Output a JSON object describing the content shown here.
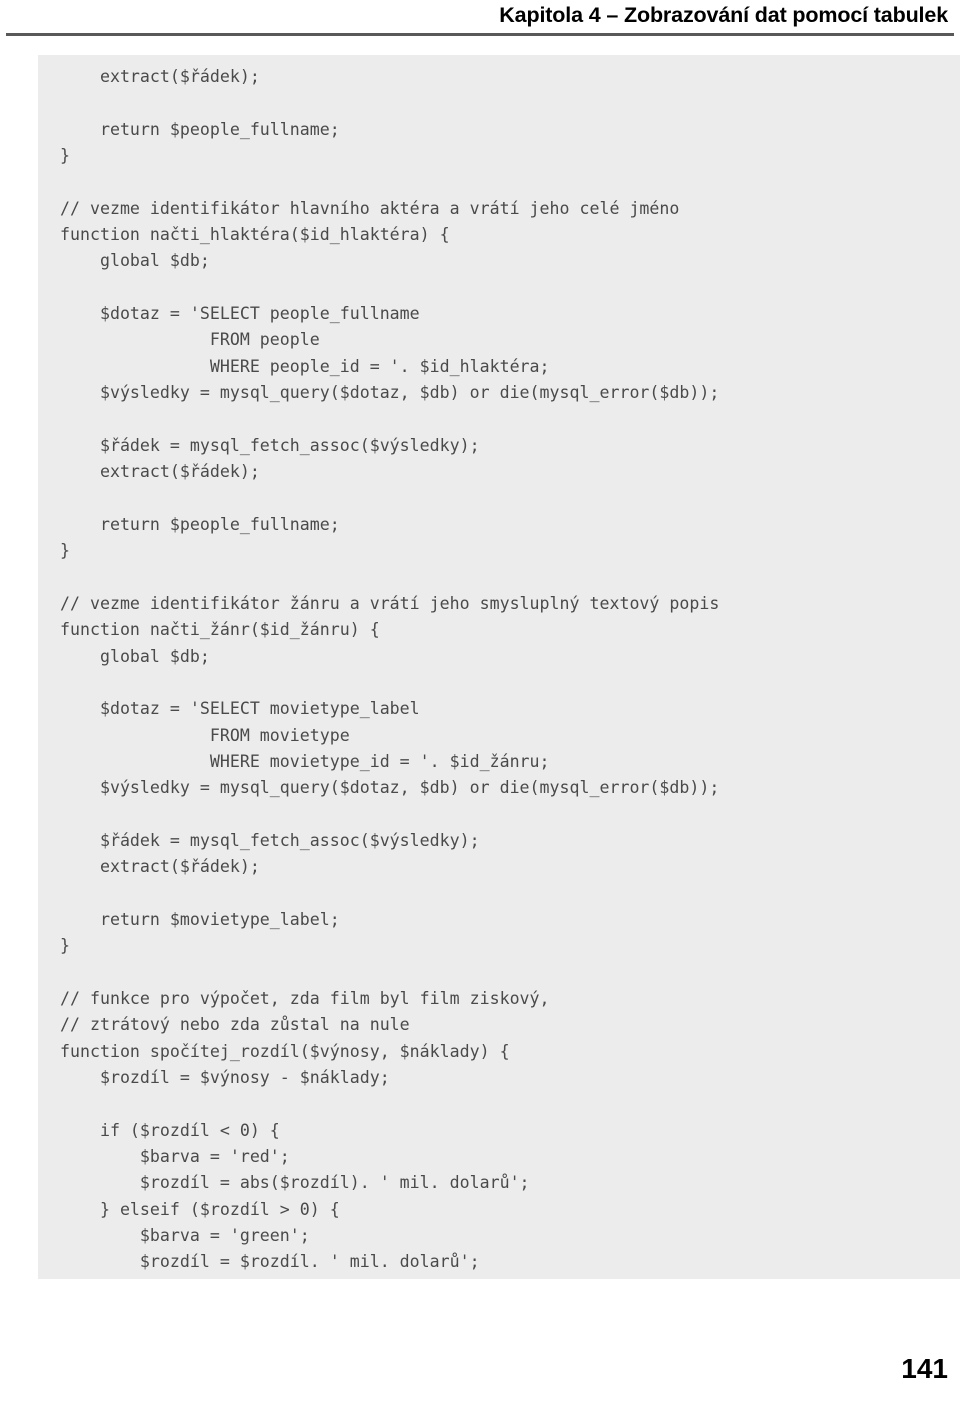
{
  "running_head": {
    "title": "Kapitola 4 – Zobrazování dat pomocí tabulek"
  },
  "folio": {
    "page_number": "141"
  },
  "code_block": {
    "language": "php",
    "background_color": "#ececec",
    "text_color": "#4a4a4a",
    "lines": [
      "    extract($řádek);",
      "",
      "    return $people_fullname;",
      "}",
      "",
      "// vezme identifikátor hlavního aktéra a vrátí jeho celé jméno",
      "function načti_hlaktéra($id_hlaktéra) {",
      "    global $db;",
      "",
      "    $dotaz = 'SELECT people_fullname",
      "               FROM people",
      "               WHERE people_id = '. $id_hlaktéra;",
      "    $výsledky = mysql_query($dotaz, $db) or die(mysql_error($db));",
      "",
      "    $řádek = mysql_fetch_assoc($výsledky);",
      "    extract($řádek);",
      "",
      "    return $people_fullname;",
      "}",
      "",
      "// vezme identifikátor žánru a vrátí jeho smysluplný textový popis",
      "function načti_žánr($id_žánru) {",
      "    global $db;",
      "",
      "    $dotaz = 'SELECT movietype_label",
      "               FROM movietype",
      "               WHERE movietype_id = '. $id_žánru;",
      "    $výsledky = mysql_query($dotaz, $db) or die(mysql_error($db));",
      "",
      "    $řádek = mysql_fetch_assoc($výsledky);",
      "    extract($řádek);",
      "",
      "    return $movietype_label;",
      "}",
      "",
      "// funkce pro výpočet, zda film byl film ziskový,",
      "// ztrátový nebo zda zůstal na nule",
      "function spočítej_rozdíl($výnosy, $náklady) {",
      "    $rozdíl = $výnosy - $náklady;",
      "",
      "    if ($rozdíl < 0) {",
      "        $barva = 'red';",
      "        $rozdíl = abs($rozdíl). ' mil. dolarů';",
      "    } elseif ($rozdíl > 0) {",
      "        $barva = 'green';",
      "        $rozdíl = $rozdíl. ' mil. dolarů';"
    ]
  }
}
